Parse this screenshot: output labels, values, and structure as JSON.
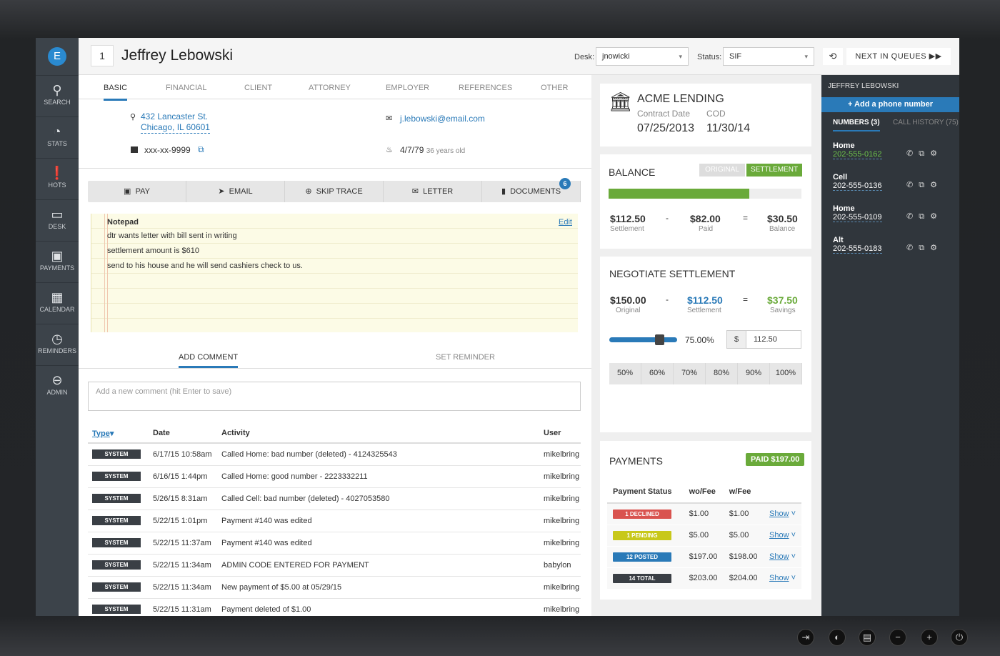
{
  "nav": {
    "items": [
      {
        "label": "SEARCH",
        "icon": "search-icon",
        "glyph": "⚲"
      },
      {
        "label": "STATS",
        "icon": "dashboard-icon",
        "glyph": "◔"
      },
      {
        "label": "HOTS",
        "icon": "exclamation-icon",
        "glyph": "❗"
      },
      {
        "label": "DESK",
        "icon": "inbox-icon",
        "glyph": "▭"
      },
      {
        "label": "PAYMENTS",
        "icon": "money-icon",
        "glyph": "▣"
      },
      {
        "label": "CALENDAR",
        "icon": "calendar-icon",
        "glyph": "▦"
      },
      {
        "label": "REMINDERS",
        "icon": "clock-icon",
        "glyph": "◷"
      },
      {
        "label": "ADMIN",
        "icon": "arrow-circle-icon",
        "glyph": "⊖"
      }
    ],
    "logo": "E"
  },
  "header": {
    "number": "1",
    "name": "Jeffrey Lebowski",
    "desk_label": "Desk:",
    "desk_value": "jnowicki",
    "status_label": "Status:",
    "status_value": "SIF",
    "next_label": "NEXT IN QUEUES"
  },
  "tabs": [
    "BASIC",
    "FINANCIAL",
    "CLIENT",
    "ATTORNEY",
    "EMPLOYER",
    "REFERENCES",
    "OTHER"
  ],
  "basic": {
    "address1": "432 Lancaster St.",
    "address2": "Chicago, IL 60601",
    "email": "j.lebowski@email.com",
    "ssn": "xxx-xx-9999",
    "dob": "4/7/79",
    "age": "36 years old"
  },
  "actions": [
    "PAY",
    "EMAIL",
    "SKIP TRACE",
    "LETTER",
    "DOCUMENTS"
  ],
  "documents_count": "6",
  "notepad": {
    "title": "Notepad",
    "edit": "Edit",
    "lines": [
      "dtr wants letter with bill sent in writing",
      "settlement amount is $610",
      "send to his house and he will send cashiers check to us."
    ]
  },
  "comment_tabs": [
    "ADD COMMENT",
    "SET REMINDER"
  ],
  "comment_placeholder": "Add a new comment (hit Enter to save)",
  "log": {
    "headers": [
      "Type",
      "Date",
      "Activity",
      "User"
    ],
    "rows": [
      [
        "SYSTEM",
        "6/17/15 10:58am",
        "Called Home: bad number (deleted) - 4124325543",
        "mikelbring"
      ],
      [
        "SYSTEM",
        "6/16/15 1:44pm",
        "Called Home: good number - 2223332211",
        "mikelbring"
      ],
      [
        "SYSTEM",
        "5/26/15 8:31am",
        "Called Cell: bad number (deleted) - 4027053580",
        "mikelbring"
      ],
      [
        "SYSTEM",
        "5/22/15 1:01pm",
        "Payment #140 was edited",
        "mikelbring"
      ],
      [
        "SYSTEM",
        "5/22/15 11:37am",
        "Payment #140 was edited",
        "mikelbring"
      ],
      [
        "SYSTEM",
        "5/22/15 11:34am",
        "ADMIN CODE ENTERED FOR PAYMENT",
        "babylon"
      ],
      [
        "SYSTEM",
        "5/22/15 11:34am",
        "New payment of $5.00 at 05/29/15",
        "mikelbring"
      ],
      [
        "SYSTEM",
        "5/22/15 11:31am",
        "Payment deleted of $1.00",
        "mikelbring"
      ]
    ]
  },
  "creditor": {
    "name": "ACME LENDING",
    "contract_label": "Contract Date",
    "cod_label": "COD",
    "contract_date": "07/25/2013",
    "cod": "11/30/14"
  },
  "balance": {
    "title": "BALANCE",
    "toggle": [
      "ORIGINAL",
      "SETTLEMENT"
    ],
    "progress_percent": 73,
    "settlement": "$112.50",
    "settlement_label": "Settlement",
    "paid": "$82.00",
    "paid_label": "Paid",
    "balance": "$30.50",
    "balance_label": "Balance",
    "minus": "-",
    "equals": "="
  },
  "negotiate": {
    "title": "NEGOTIATE SETTLEMENT",
    "original": "$150.00",
    "original_label": "Original",
    "settlement": "$112.50",
    "settlement_label": "Settlement",
    "savings": "$37.50",
    "savings_label": "Savings",
    "slider_percent": 75,
    "percent_text": "75.00%",
    "currency": "$",
    "amount": "112.50",
    "presets": [
      "50%",
      "60%",
      "70%",
      "80%",
      "90%",
      "100%"
    ]
  },
  "payments": {
    "title": "PAYMENTS",
    "paid_badge": "PAID $197.00",
    "headers": [
      "Payment Status",
      "wo/Fee",
      "w/Fee",
      ""
    ],
    "rows": [
      {
        "status": "1 DECLINED",
        "color": "#d9534f",
        "wo": "$1.00",
        "w": "$1.00",
        "link": "Show"
      },
      {
        "status": "1 PENDING",
        "color": "#c8c81a",
        "wo": "$5.00",
        "w": "$5.00",
        "link": "Show"
      },
      {
        "status": "12 POSTED",
        "color": "#2a7ab8",
        "wo": "$197.00",
        "w": "$198.00",
        "link": "Show"
      },
      {
        "status": "14 TOTAL",
        "color": "#3a3f45",
        "wo": "$203.00",
        "w": "$204.00",
        "link": "Show"
      }
    ]
  },
  "phones": {
    "title": "JEFFREY LEBOWSKI",
    "add": "+ Add a phone number",
    "tabs": [
      "NUMBERS (3)",
      "CALL HISTORY (75)"
    ],
    "items": [
      {
        "type": "Home",
        "number": "202-555-0162",
        "color": "#6cc04a"
      },
      {
        "type": "Cell",
        "number": "202-555-0136",
        "color": "#ffffff"
      },
      {
        "type": "Home",
        "number": "202-555-0109",
        "color": "#ffffff"
      },
      {
        "type": "Alt",
        "number": "202-555-0183",
        "color": "#ffffff"
      }
    ]
  },
  "colors": {
    "accent": "#2a7ab8",
    "success": "#6aaa3a",
    "nav": "#3c434a"
  }
}
